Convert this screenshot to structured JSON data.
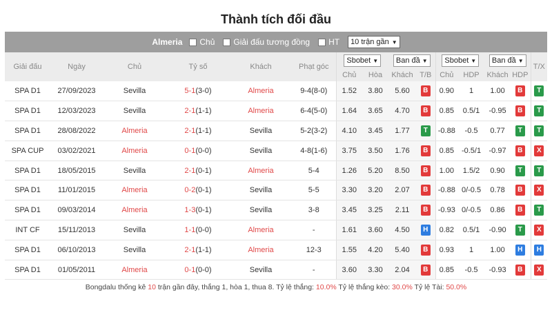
{
  "title": "Thành tích đối đầu",
  "filter": {
    "team": "Almeria",
    "opt_home": "Chủ",
    "opt_same": "Giải đấu tương đồng",
    "opt_ht": "HT",
    "select": "10 trận gần"
  },
  "headers": {
    "league": "Giải đấu",
    "date": "Ngày",
    "home": "Chủ",
    "score": "Tỷ số",
    "away": "Khách",
    "corner": "Phạt góc",
    "odds_sel1": "Sbobet",
    "odds_sel2": "Ban đầ",
    "ah_sel1": "Sbobet",
    "ah_sel2": "Ban đầ",
    "tx": "T/X",
    "sub": [
      "Chủ",
      "Hòa",
      "Khách",
      "T/B",
      "Chủ",
      "HDP",
      "Khách",
      "HDP"
    ]
  },
  "rows": [
    {
      "league": "SPA D1",
      "date": "27/09/2023",
      "home": "Sevilla",
      "home_red": false,
      "score": "5-1",
      "ht": "(3-0)",
      "away": "Almeria",
      "away_red": true,
      "corner": "9-4(8-0)",
      "o1": "1.52",
      "o2": "3.80",
      "o3": "5.60",
      "tb": "B",
      "ah1": "0.90",
      "hdp": "1",
      "ah2": "1.00",
      "hdpr": "B",
      "tx": "T"
    },
    {
      "league": "SPA D1",
      "date": "12/03/2023",
      "home": "Sevilla",
      "home_red": false,
      "score": "2-1",
      "ht": "(1-1)",
      "away": "Almeria",
      "away_red": true,
      "corner": "6-4(5-0)",
      "o1": "1.64",
      "o2": "3.65",
      "o3": "4.70",
      "tb": "B",
      "ah1": "0.85",
      "hdp": "0.5/1",
      "ah2": "-0.95",
      "hdpr": "B",
      "tx": "T"
    },
    {
      "league": "SPA D1",
      "date": "28/08/2022",
      "home": "Almeria",
      "home_red": true,
      "score": "2-1",
      "ht": "(1-1)",
      "away": "Sevilla",
      "away_red": false,
      "corner": "5-2(3-2)",
      "o1": "4.10",
      "o2": "3.45",
      "o3": "1.77",
      "tb": "T",
      "ah1": "-0.88",
      "hdp": "-0.5",
      "ah2": "0.77",
      "hdpr": "T",
      "tx": "T"
    },
    {
      "league": "SPA CUP",
      "date": "03/02/2021",
      "home": "Almeria",
      "home_red": true,
      "score": "0-1",
      "ht": "(0-0)",
      "away": "Sevilla",
      "away_red": false,
      "corner": "4-8(1-6)",
      "o1": "3.75",
      "o2": "3.50",
      "o3": "1.76",
      "tb": "B",
      "ah1": "0.85",
      "hdp": "-0.5/1",
      "ah2": "-0.97",
      "hdpr": "B",
      "tx": "X"
    },
    {
      "league": "SPA D1",
      "date": "18/05/2015",
      "home": "Sevilla",
      "home_red": false,
      "score": "2-1",
      "ht": "(0-1)",
      "away": "Almeria",
      "away_red": true,
      "corner": "5-4",
      "o1": "1.26",
      "o2": "5.20",
      "o3": "8.50",
      "tb": "B",
      "ah1": "1.00",
      "hdp": "1.5/2",
      "ah2": "0.90",
      "hdpr": "T",
      "tx": "T"
    },
    {
      "league": "SPA D1",
      "date": "11/01/2015",
      "home": "Almeria",
      "home_red": true,
      "score": "0-2",
      "ht": "(0-1)",
      "away": "Sevilla",
      "away_red": false,
      "corner": "5-5",
      "o1": "3.30",
      "o2": "3.20",
      "o3": "2.07",
      "tb": "B",
      "ah1": "-0.88",
      "hdp": "0/-0.5",
      "ah2": "0.78",
      "hdpr": "B",
      "tx": "X"
    },
    {
      "league": "SPA D1",
      "date": "09/03/2014",
      "home": "Almeria",
      "home_red": true,
      "score": "1-3",
      "ht": "(0-1)",
      "away": "Sevilla",
      "away_red": false,
      "corner": "3-8",
      "o1": "3.45",
      "o2": "3.25",
      "o3": "2.11",
      "tb": "B",
      "ah1": "-0.93",
      "hdp": "0/-0.5",
      "ah2": "0.86",
      "hdpr": "B",
      "tx": "T"
    },
    {
      "league": "INT CF",
      "date": "15/11/2013",
      "home": "Sevilla",
      "home_red": false,
      "score": "1-1",
      "ht": "(0-0)",
      "away": "Almeria",
      "away_red": true,
      "corner": "-",
      "o1": "1.61",
      "o2": "3.60",
      "o3": "4.50",
      "tb": "H",
      "ah1": "0.82",
      "hdp": "0.5/1",
      "ah2": "-0.90",
      "hdpr": "T",
      "tx": "X"
    },
    {
      "league": "SPA D1",
      "date": "06/10/2013",
      "home": "Sevilla",
      "home_red": false,
      "score": "2-1",
      "ht": "(1-1)",
      "away": "Almeria",
      "away_red": true,
      "corner": "12-3",
      "o1": "1.55",
      "o2": "4.20",
      "o3": "5.40",
      "tb": "B",
      "ah1": "0.93",
      "hdp": "1",
      "ah2": "1.00",
      "hdpr": "H",
      "tx": "H"
    },
    {
      "league": "SPA D1",
      "date": "01/05/2011",
      "home": "Almeria",
      "home_red": true,
      "score": "0-1",
      "ht": "(0-0)",
      "away": "Sevilla",
      "away_red": false,
      "corner": "-",
      "o1": "3.60",
      "o2": "3.30",
      "o3": "2.04",
      "tb": "B",
      "ah1": "0.85",
      "hdp": "-0.5",
      "ah2": "-0.93",
      "hdpr": "B",
      "tx": "X"
    }
  ],
  "footer": {
    "p1": "Bongdalu thống kê ",
    "n": "10",
    "p2": " trận gần đây, thắng 1, hòa 1, thua 8. Tỷ lệ thắng: ",
    "win": "10.0%",
    "p3": " Tỷ lệ thắng kèo: ",
    "ah": "30.0%",
    "p4": " Tỷ lệ Tài: ",
    "over": "50.0%"
  },
  "colors": {
    "red": "#e23a3a",
    "green": "#2a9a4a",
    "blue": "#2e7de0",
    "filter_bar": "#9e9e9e"
  }
}
